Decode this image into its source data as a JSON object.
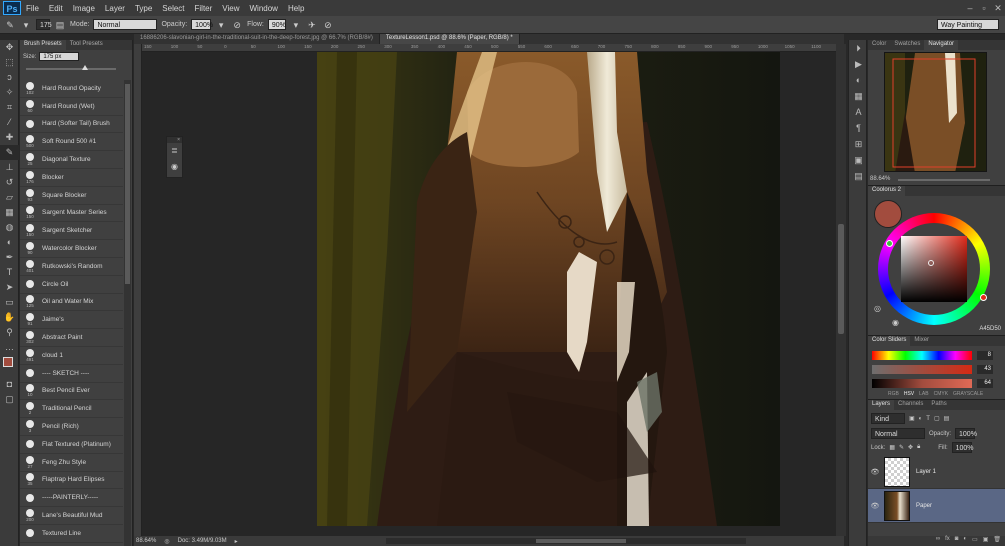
{
  "menubar": {
    "logo": "Ps",
    "items": [
      "File",
      "Edit",
      "Image",
      "Layer",
      "Type",
      "Select",
      "Filter",
      "View",
      "Window",
      "Help"
    ],
    "window_controls": [
      "–",
      "▫",
      "✕"
    ]
  },
  "options": {
    "brush_size": "175",
    "mode_label": "Mode:",
    "mode_value": "Normal",
    "opacity_label": "Opacity:",
    "opacity_value": "100%",
    "flow_label": "Flow:",
    "flow_value": "90%",
    "workspace": "Way Painting"
  },
  "brush_panel": {
    "tabs": [
      "Brush Presets",
      "Tool Presets"
    ],
    "size_label": "Size:",
    "size_value": "175 px",
    "brushes": [
      {
        "num": "102",
        "name": "Hard Round Opacity"
      },
      {
        "num": "60",
        "name": "Hard Round (Wet)"
      },
      {
        "num": "",
        "name": "Hard (Softer Tail) Brush"
      },
      {
        "num": "500",
        "name": "Soft Round 500 #1"
      },
      {
        "num": "25",
        "name": "Diagonal Texture"
      },
      {
        "num": "176",
        "name": "Blocker"
      },
      {
        "num": "93",
        "name": "Square Blocker"
      },
      {
        "num": "150",
        "name": "Sargent Master Series"
      },
      {
        "num": "150",
        "name": "Sargent Sketcher"
      },
      {
        "num": "90",
        "name": "Watercolor Blocker"
      },
      {
        "num": "401",
        "name": "Rutkowski's Random"
      },
      {
        "num": "",
        "name": "Circle Oil"
      },
      {
        "num": "125",
        "name": "Oil and Water Mix"
      },
      {
        "num": "91",
        "name": "Jaime's"
      },
      {
        "num": "302",
        "name": "Abstract Paint"
      },
      {
        "num": "491",
        "name": "cloud 1"
      },
      {
        "num": "",
        "name": "---- SKETCH ----"
      },
      {
        "num": "10",
        "name": "Best Pencil Ever"
      },
      {
        "num": "2",
        "name": "Traditional Pencil"
      },
      {
        "num": "3",
        "name": "Pencil (Rich)"
      },
      {
        "num": "",
        "name": "Flat Textured (Platinum)"
      },
      {
        "num": "27",
        "name": "Feng Zhu Style"
      },
      {
        "num": "35",
        "name": "Flaptrap Hard Elipses"
      },
      {
        "num": "",
        "name": "-----PAINTERLY-----"
      },
      {
        "num": "200",
        "name": "Lane's Beautiful Mud"
      },
      {
        "num": "",
        "name": "Textured Line"
      }
    ]
  },
  "documents": {
    "tabs": [
      {
        "label": "16886206-slavonian-girl-in-the-traditional-suit-in-the-deep-forest.jpg @ 66.7% (RGB/8#)",
        "active": false
      },
      {
        "label": "TextureLesson1.psd @ 88.6% (Paper, RGB/8) *",
        "active": true
      }
    ],
    "ruler_ticks": [
      "150",
      "100",
      "50",
      "0",
      "50",
      "100",
      "150",
      "200",
      "250",
      "300",
      "350",
      "400",
      "450",
      "500",
      "550",
      "600",
      "650",
      "700",
      "750",
      "800",
      "850",
      "900",
      "950",
      "1000",
      "1050",
      "1100"
    ]
  },
  "status": {
    "zoom": "88.64%",
    "doc_size": "Doc: 3.49M/9.03M"
  },
  "navigator": {
    "tabs": [
      "Color",
      "Swatches",
      "Navigator"
    ],
    "zoom": "88.64%"
  },
  "coolorus": {
    "title": "Coolorus 2",
    "hex": "A45D50",
    "current_color": "#a24c3e"
  },
  "sliders": {
    "tabs": [
      "Color Sliders",
      "Mixer"
    ],
    "values": [
      "8",
      "43",
      "64"
    ],
    "modes": [
      "RGB",
      "HSV",
      "LAB",
      "CMYK",
      "GRAYSCALE"
    ]
  },
  "layers": {
    "tabs": [
      "Layers",
      "Channels",
      "Paths"
    ],
    "kind_label": "Kind",
    "blend_mode": "Normal",
    "opacity_label": "Opacity:",
    "opacity_value": "100%",
    "lock_label": "Lock:",
    "fill_label": "Fill:",
    "fill_value": "100%",
    "items": [
      {
        "name": "Layer 1",
        "selected": false
      },
      {
        "name": "Paper",
        "selected": true
      }
    ]
  }
}
